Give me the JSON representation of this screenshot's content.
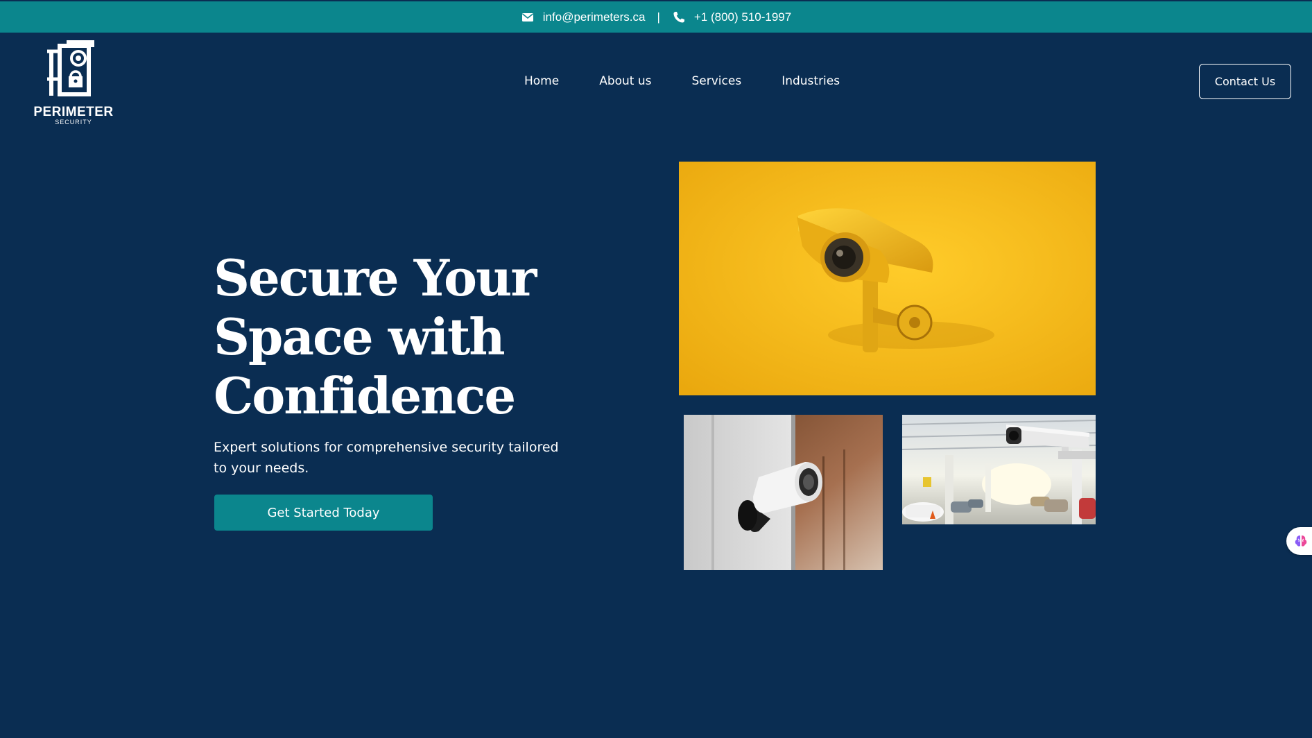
{
  "topbar": {
    "email": "info@perimeters.ca",
    "separator": "|",
    "phone": "+1 (800) 510-1997",
    "email_icon": "envelope-icon",
    "phone_icon": "phone-icon"
  },
  "logo": {
    "name": "PERIMETER",
    "sub": "SECURITY"
  },
  "nav": {
    "items": [
      {
        "label": "Home"
      },
      {
        "label": "About us"
      },
      {
        "label": "Services"
      },
      {
        "label": "Industries"
      }
    ]
  },
  "header": {
    "contact_label": "Contact Us"
  },
  "hero": {
    "title_line1": "Secure Your",
    "title_line2": "Space with",
    "title_line3": "Confidence",
    "subtitle": "Expert solutions for comprehensive security tailored to your needs.",
    "cta_label": "Get Started Today"
  },
  "images": {
    "main": "yellow-cctv-camera-photo",
    "wall": "wall-mounted-security-camera-photo",
    "garage": "parking-garage-camera-photo"
  },
  "widget": {
    "icon": "brain-icon"
  },
  "colors": {
    "background": "#0a2d52",
    "accent": "#0b868d",
    "yellow": "#f5b515",
    "text": "#ffffff"
  }
}
